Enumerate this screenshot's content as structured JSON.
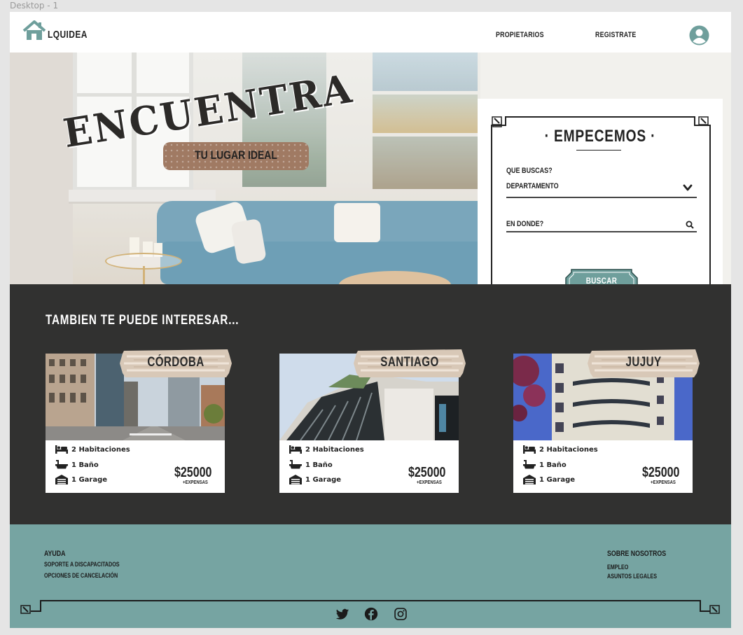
{
  "frame": {
    "label": "Desktop - 1"
  },
  "nav": {
    "logo_text": "LQUIDEA",
    "links": [
      "PROPIETARIOS",
      "REGISTRATE"
    ],
    "avatar_icon": "user-circle-icon"
  },
  "hero": {
    "headline": "ENCUENTRA",
    "tagline": "TU LUGAR IDEAL"
  },
  "search": {
    "title": "· EMPECEMOS ·",
    "que_label": "QUE BUSCAS?",
    "que_value": "DEPARTAMENTO",
    "donde_placeholder": "EN DONDE?",
    "button": "BUSCAR"
  },
  "listings": {
    "title": "TAMBIEN TE PUEDE INTERESAR...",
    "cards": [
      {
        "city": "CÓRDOBA",
        "rooms": "2 Habitaciones",
        "baths": "1 Baño",
        "garage": "1 Garage",
        "price": "$25000",
        "extra": "+EXPENSAS"
      },
      {
        "city": "SANTIAGO",
        "rooms": "2 Habitaciones",
        "baths": "1 Baño",
        "garage": "1 Garage",
        "price": "$25000",
        "extra": "+EXPENSAS"
      },
      {
        "city": "JUJUY",
        "rooms": "2 Habitaciones",
        "baths": "1 Baño",
        "garage": "1 Garage",
        "price": "$25000",
        "extra": "+EXPENSAS"
      }
    ]
  },
  "footer": {
    "help": {
      "heading": "AYUDA",
      "items": [
        "SOPORTE A DISCAPACITADOS",
        "OPCIONES DE CANCELACIÓN"
      ]
    },
    "about": {
      "heading": "SOBRE NOSOTROS",
      "items": [
        "EMPLEO",
        "ASUNTOS LEGALES"
      ]
    },
    "social": [
      "twitter-icon",
      "facebook-icon",
      "instagram-icon"
    ]
  },
  "colors": {
    "teal": "#76a4a2",
    "dark": "#313130",
    "tag_brown": "#a07a63",
    "button_teal": "#6f9f9c"
  }
}
